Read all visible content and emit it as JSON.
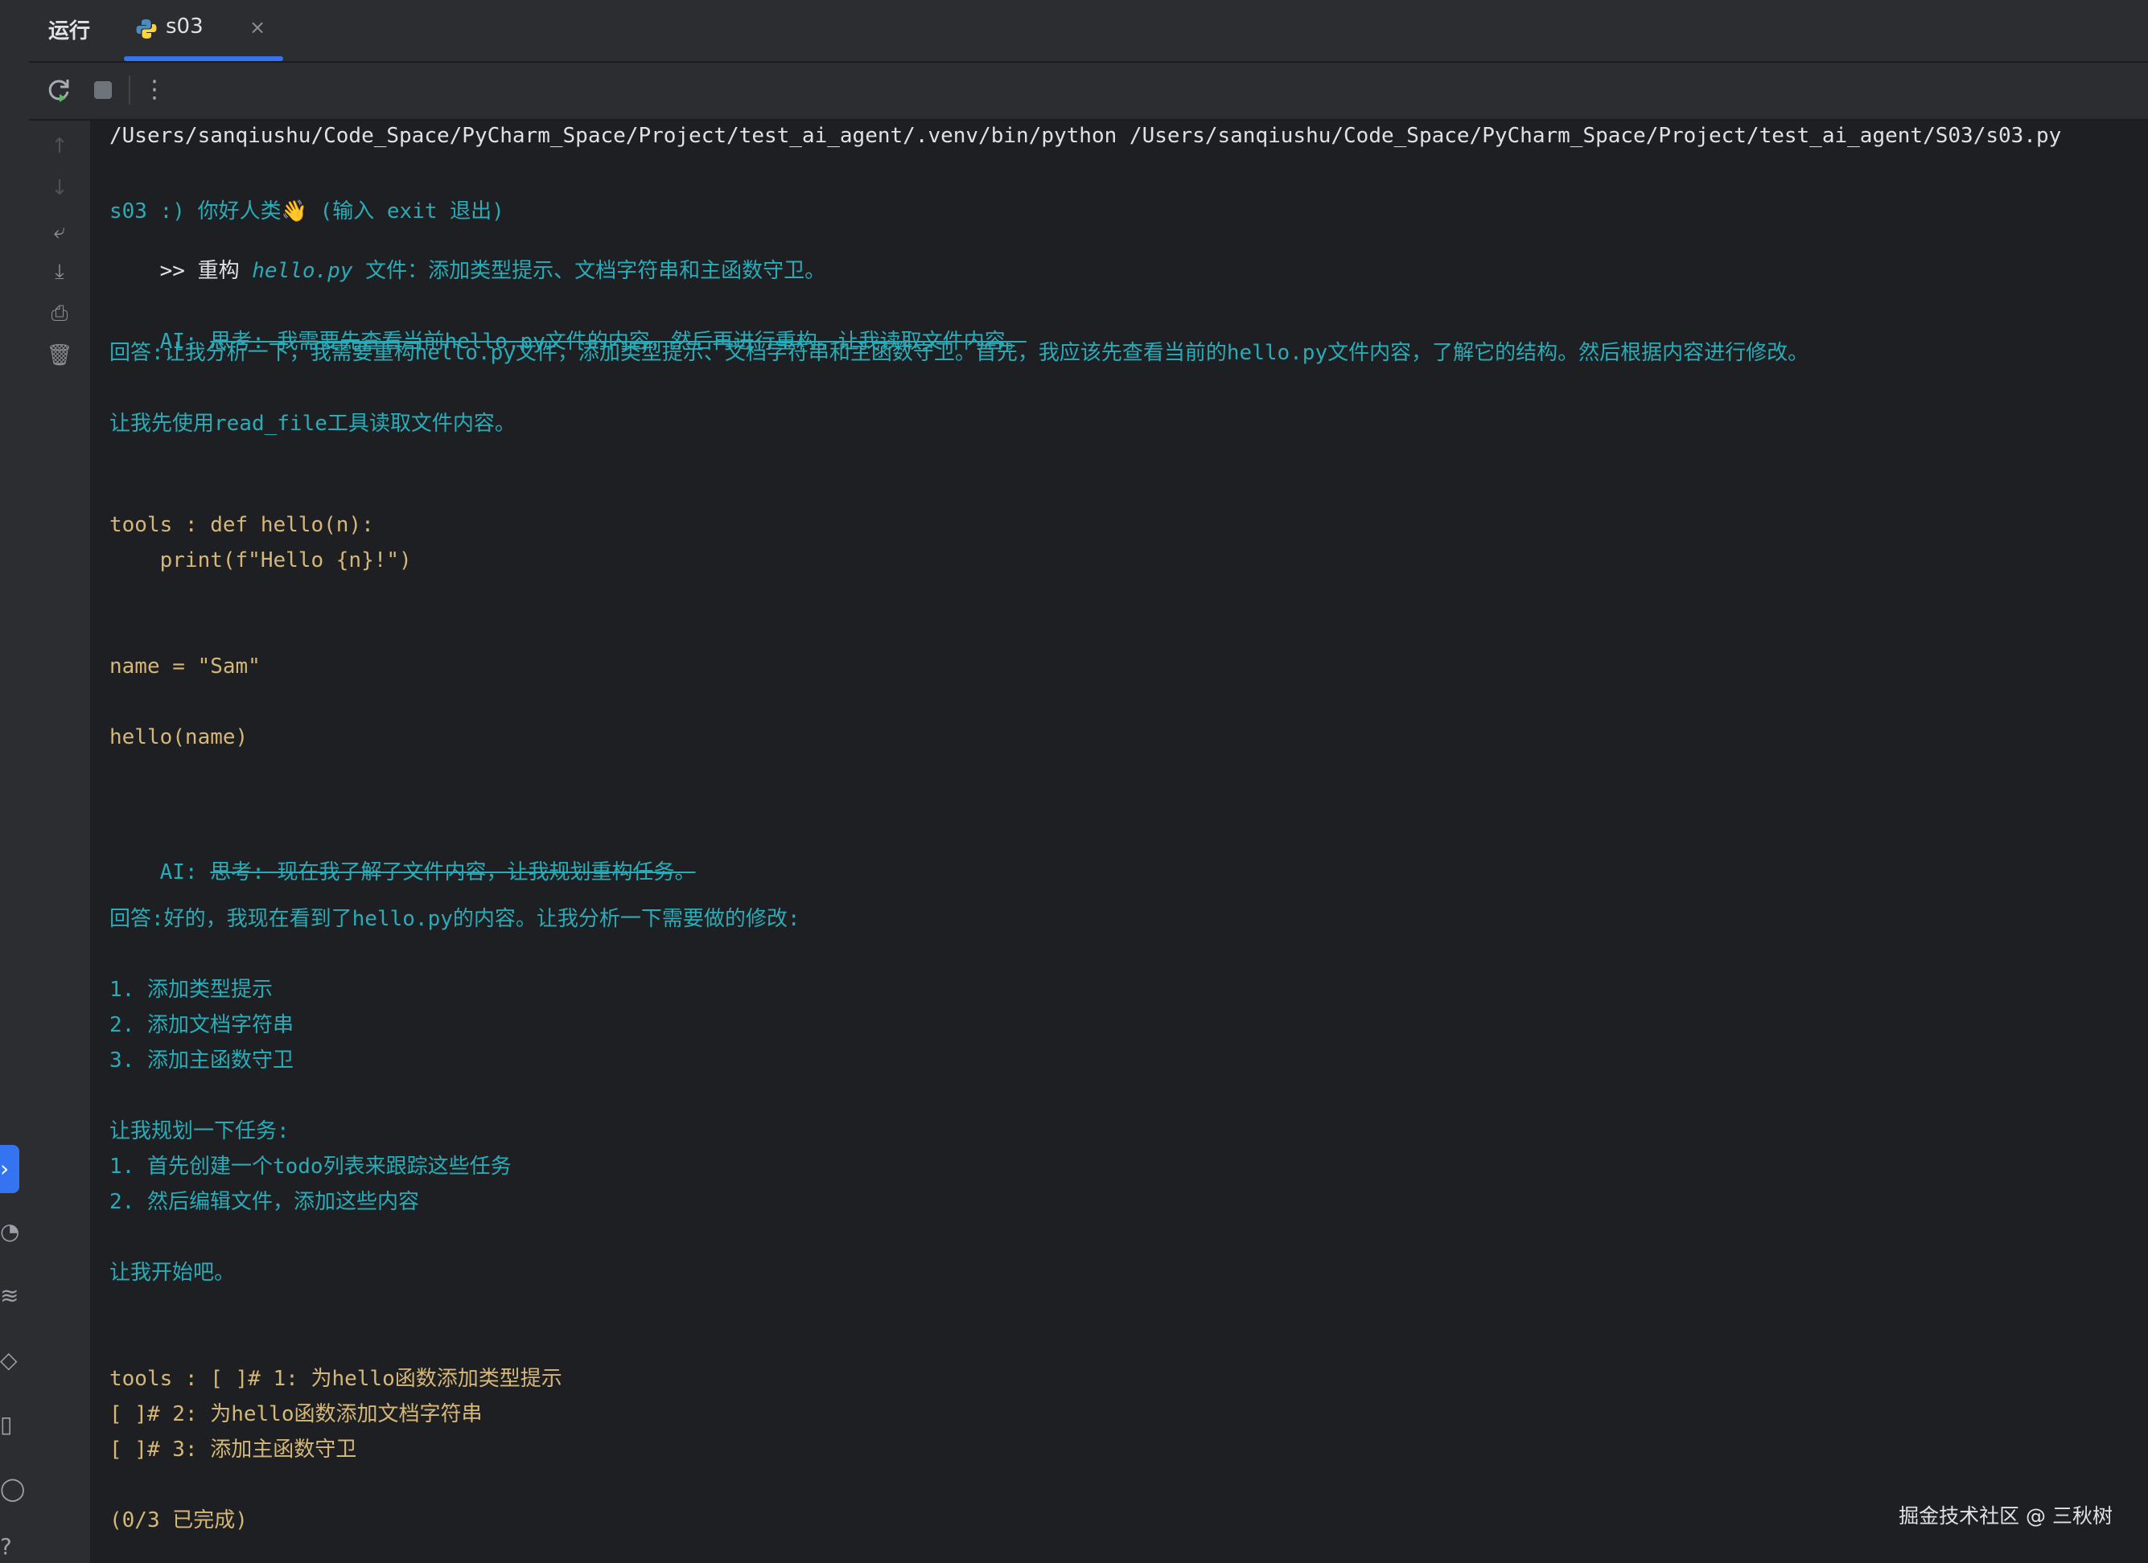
{
  "tabbar": {
    "run_label": "运行",
    "tab_title": "s03",
    "close_glyph": "×"
  },
  "toolbar": {
    "icons": [
      "rerun-icon",
      "stop-icon",
      "more-vertical-icon"
    ]
  },
  "gutter": {
    "icons": [
      "scroll-up-icon",
      "scroll-down-icon",
      "soft-wrap-icon",
      "scroll-to-end-icon",
      "print-icon",
      "trash-icon"
    ]
  },
  "left_strip": {
    "icons": [
      "run-tool-icon",
      "python-console-icon",
      "layers-icon",
      "git-icon",
      "terminal-icon",
      "problems-icon",
      "services-icon"
    ]
  },
  "console": {
    "command_line": "/Users/sanqiushu/Code_Space/PyCharm_Space/Project/test_ai_agent/.venv/bin/python /Users/sanqiushu/Code_Space/PyCharm_Space/Project/test_ai_agent/S03/s03.py",
    "greeting": "s03 :) 你好人类👋 (输入 exit 退出)",
    "prompt_prefix": ">> 重构 ",
    "prompt_file": "hello.py",
    "prompt_suffix": " 文件：添加类型提示、文档字符串和主函数守卫。",
    "ai1_prefix": "AI: ",
    "ai1_thinking": "思考: 我需要先查看当前hello.py文件的内容，然后再进行重构。让我读取文件内容。",
    "answer1": "回答:让我分析一下，我需要重构hello.py文件，添加类型提示、文档字符串和主函数守卫。首先，我应该先查看当前的hello.py文件内容，了解它的结构。然后根据内容进行修改。",
    "read_line": "让我先使用read_file工具读取文件内容。",
    "tools1_a": "tools : def hello(n):",
    "tools1_b": "    print(f\"Hello {n}!\")",
    "tools1_c": "name = \"Sam\"",
    "tools1_d": "hello(name)",
    "ai2_prefix": "AI: ",
    "ai2_thinking": "思考: 现在我了解了文件内容，让我规划重构任务。",
    "answer2": "回答:好的，我现在看到了hello.py的内容。让我分析一下需要做的修改:",
    "list1": [
      "1. 添加类型提示",
      "2. 添加文档字符串",
      "3. 添加主函数守卫"
    ],
    "plan_title": "让我规划一下任务:",
    "plan": [
      "1. 首先创建一个todo列表来跟踪这些任务",
      "2. 然后编辑文件，添加这些内容"
    ],
    "start": "让我开始吧。",
    "todo": [
      "tools : [ ]# 1: 为hello函数添加类型提示",
      "[ ]# 2: 为hello函数添加文档字符串",
      "[ ]# 3: 添加主函数守卫"
    ],
    "progress": "(0/3 已完成)"
  },
  "watermark": "掘金技术社区 @ 三秋树",
  "colors": {
    "accent": "#3574f0",
    "teal": "#2aacb8",
    "yellow": "#d5b778",
    "background": "#1e1f22"
  }
}
